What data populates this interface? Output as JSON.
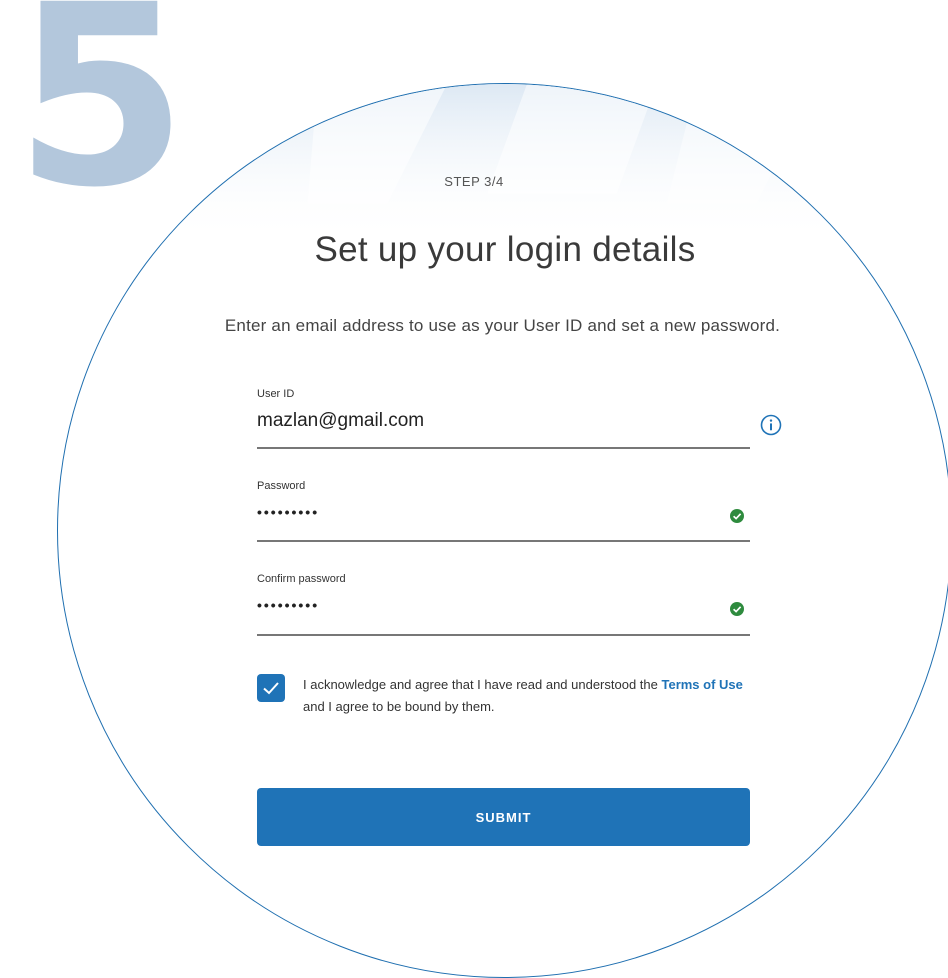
{
  "step_number": "5",
  "form": {
    "step_label": "STEP 3/4",
    "title": "Set up your login details",
    "subtitle": "Enter an email address to use as your User ID and set a new password.",
    "user_id": {
      "label": "User ID",
      "value": "mazlan@gmail.com"
    },
    "password": {
      "label": "Password",
      "value": "•••••••••"
    },
    "confirm_password": {
      "label": "Confirm password",
      "value": "•••••••••"
    },
    "agreement": {
      "checked": true,
      "text_before": "I acknowledge and agree that I have read and understood the ",
      "link": "Terms of Use",
      "text_after": " and I agree to be bound by them."
    },
    "submit_label": "SUBMIT"
  },
  "colors": {
    "accent": "#1f73b7",
    "step_number": "#b3c7dc",
    "success": "#2e8b3e"
  },
  "icons": {
    "user_id": "info-icon",
    "password": "check-circle-icon",
    "confirm_password": "check-circle-icon",
    "checkbox": "checkmark-icon"
  }
}
